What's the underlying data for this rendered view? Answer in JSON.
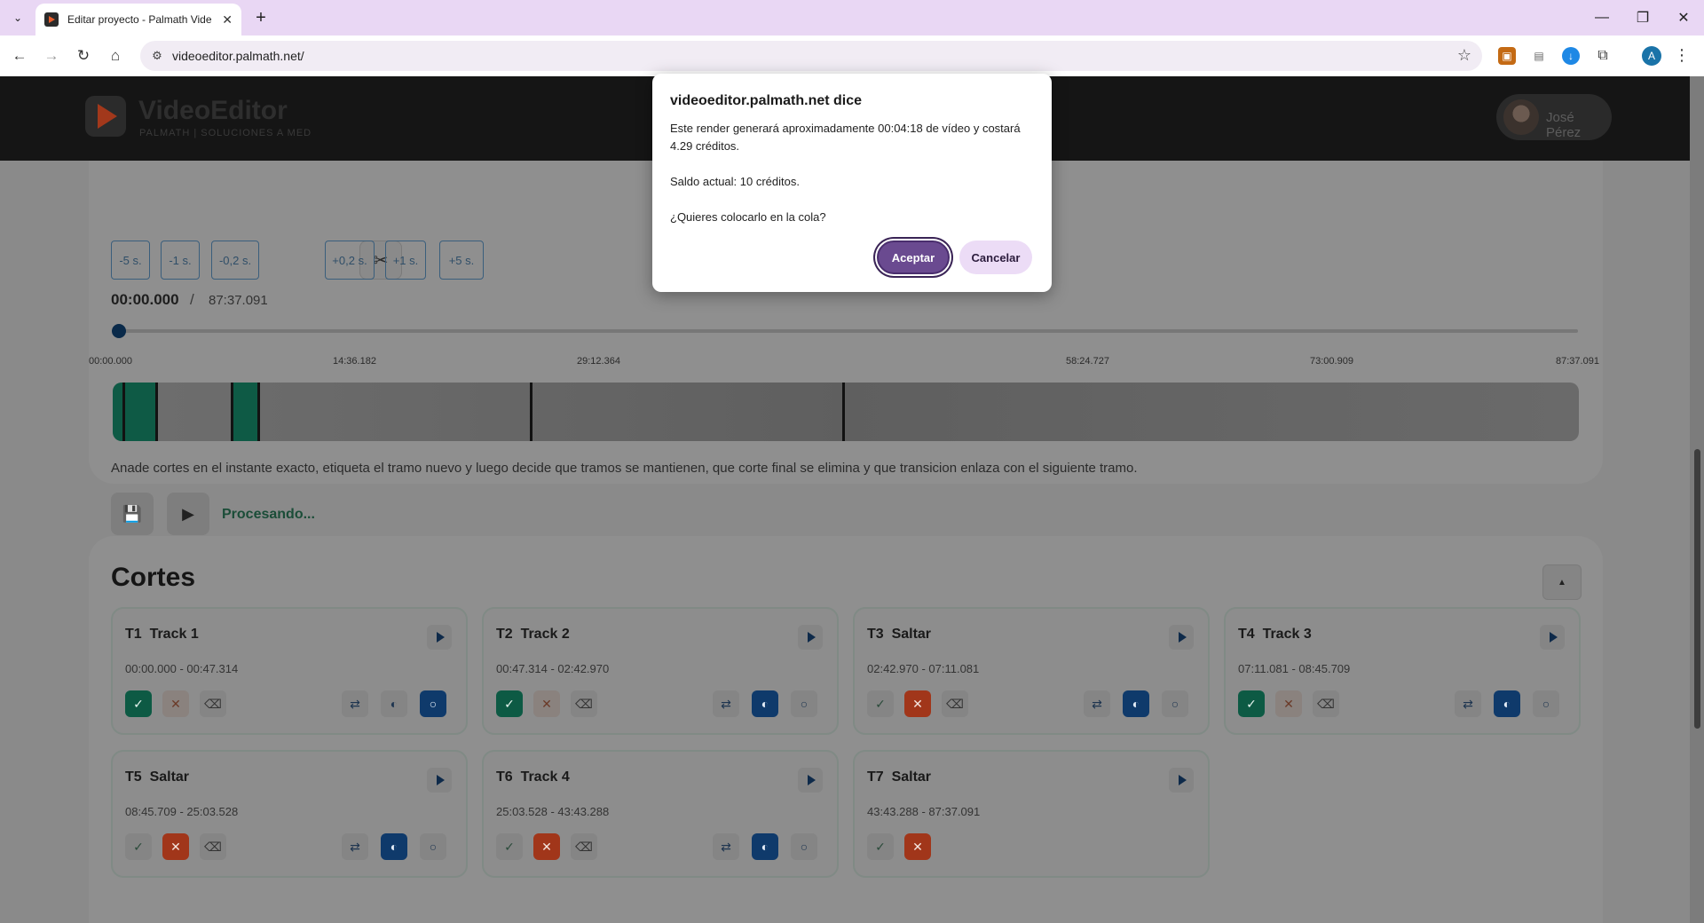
{
  "browser": {
    "tab_title": "Editar proyecto - Palmath Vide",
    "url": "videoeditor.palmath.net/",
    "profile_initial": "A"
  },
  "header": {
    "brand": "VideoEditor",
    "brand_sub": "PALMATH | SOLUCIONES A MED",
    "user_name": "José Pérez"
  },
  "player": {
    "step_buttons": [
      "-5 s.",
      "-1 s.",
      "-0,2 s.",
      "+0,2 s.",
      "+1 s.",
      "+5 s."
    ],
    "time_current": "00:00.000",
    "time_sep": "/",
    "time_total": "87:37.091",
    "ticks": [
      "00:00.000",
      "14:36.182",
      "29:12.364",
      "58:24.727",
      "73:00.909",
      "87:37.091"
    ],
    "help_text": "Anade cortes en el instante exacto, etiqueta el tramo nuevo y luego decide que tramos se mantienen, que corte final se elimina y que transicion enlaza con el siguiente tramo.",
    "status": "Procesando..."
  },
  "cortes": {
    "title": "Cortes",
    "segments": [
      {
        "id": "T1",
        "name": "Track 1",
        "range": "00:00.000 - 00:47.314"
      },
      {
        "id": "T2",
        "name": "Track 2",
        "range": "00:47.314 - 02:42.970"
      },
      {
        "id": "T3",
        "name": "Saltar",
        "range": "02:42.970 - 07:11.081"
      },
      {
        "id": "T4",
        "name": "Track 3",
        "range": "07:11.081 - 08:45.709"
      },
      {
        "id": "T5",
        "name": "Saltar",
        "range": "08:45.709 - 25:03.528"
      },
      {
        "id": "T6",
        "name": "Track 4",
        "range": "25:03.528 - 43:43.288"
      },
      {
        "id": "T7",
        "name": "Saltar",
        "range": "43:43.288 - 87:37.091"
      }
    ]
  },
  "dialog": {
    "title": "videoeditor.palmath.net dice",
    "line1": "Este render generará aproximadamente 00:04:18 de vídeo y costará 4.29 créditos.",
    "line2": "Saldo actual: 10 créditos.",
    "line3": "¿Quieres colocarlo en la cola?",
    "accept": "Aceptar",
    "cancel": "Cancelar"
  },
  "colors": {
    "keep_on": "#0d5a44",
    "drop_on": "#a1361a",
    "transition_on": "#0f3a6b",
    "accent": "#6a4a90"
  }
}
